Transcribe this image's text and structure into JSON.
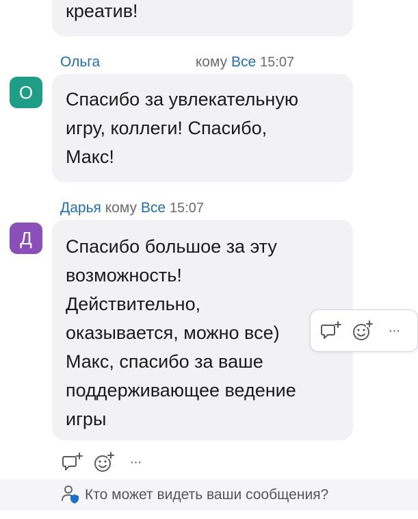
{
  "messages": [
    {
      "text": "креатив!"
    },
    {
      "sender": "Ольга",
      "to_word": "кому",
      "recipient": "Все",
      "time": "15:07",
      "avatar_letter": "О",
      "avatar_color": "#1e9e86",
      "text": "Спасибо за увлекательную\nигру, коллеги! Спасибо,\nМакс!"
    },
    {
      "sender": "Дарья",
      "to_word": "кому",
      "recipient": "Все",
      "time": "15:07",
      "avatar_letter": "Д",
      "avatar_color": "#8a4fb8",
      "text": "Спасибо большое за эту\nвозможность!\nДействительно,\nоказывается, можно все)\nМакс, спасибо за ваше\nподдерживающее ведение\nигры"
    }
  ],
  "hover_toolbar": {
    "icons": [
      "reply-in-thread-icon",
      "add-reaction-icon",
      "more-options-icon"
    ],
    "more_label": "···"
  },
  "reaction_row": {
    "icons": [
      "reply-in-thread-icon",
      "add-reaction-icon",
      "more-options-icon"
    ],
    "more_label": "···"
  },
  "privacy_notice": {
    "icon": "person-shield-icon",
    "text": "Кто может видеть ваши сообщения?"
  },
  "colors": {
    "link_blue": "#1f6db5",
    "bubble_bg": "#f2f2f5",
    "icon_gray": "#5a5a5a",
    "shield_blue": "#1a6fd1"
  }
}
